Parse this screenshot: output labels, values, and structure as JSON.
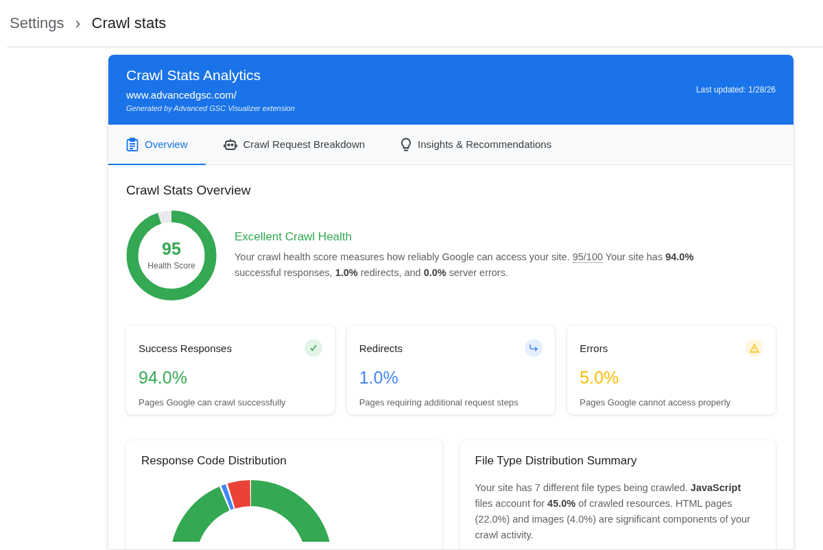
{
  "breadcrumb": {
    "parent": "Settings",
    "separator": "›",
    "current": "Crawl stats"
  },
  "header": {
    "title": "Crawl Stats Analytics",
    "site": "www.advancedgsc.com/",
    "generator": "Generated by Advanced GSC Visualizer extension",
    "updated": "Last updated: 1/28/26"
  },
  "tabs": [
    {
      "label": "Overview",
      "kind": "clipboard",
      "selected": true
    },
    {
      "label": "Crawl Request Breakdown",
      "kind": "robot",
      "selected": false
    },
    {
      "label": "Insights & Recommendations",
      "kind": "bulb",
      "selected": false
    }
  ],
  "overview": {
    "title": "Crawl Stats Overview",
    "health": {
      "score": "95",
      "label": "Health Score",
      "level": 0.95,
      "heading": "Excellent Crawl Health",
      "text_before": "Your crawl health score measures how reliably Google can access your site. ",
      "score_ref": "95/100",
      "text_after": " Your site has **94.0%** successful responses, **1.0%** redirects, and **0.0%** server errors."
    },
    "stats": [
      {
        "kind": "check",
        "title": "Success Responses",
        "value": "94.0%",
        "caption": "Pages Google can crawl successfully",
        "color": "#34a853"
      },
      {
        "kind": "redirect",
        "title": "Redirects",
        "value": "1.0%",
        "caption": "Pages requiring additional request steps",
        "color": "#4285f4"
      },
      {
        "kind": "warning",
        "title": "Errors",
        "value": "5.0%",
        "caption": "Pages Google cannot access properly",
        "color": "#fbbc04"
      }
    ]
  },
  "response_distribution": {
    "title": "Response Code Distribution"
  },
  "file_type_summary": {
    "title": "File Type Distribution Summary",
    "text": "Your site has 7 different file types being crawled. **JavaScript** files account for **45.0%** of crawled resources. HTML pages (22.0%) and images (4.0%) are significant components of your crawl activity."
  }
}
